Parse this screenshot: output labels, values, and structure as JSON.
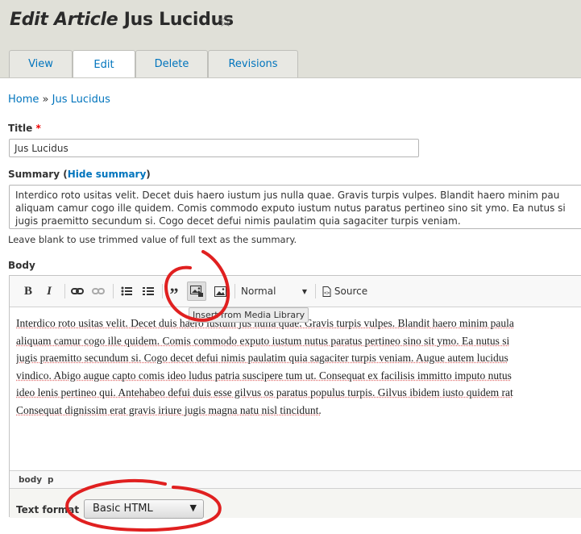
{
  "page": {
    "title_prefix": "Edit Article",
    "title_name": "Jus Lucidus"
  },
  "tabs": [
    {
      "label": "View"
    },
    {
      "label": "Edit"
    },
    {
      "label": "Delete"
    },
    {
      "label": "Revisions"
    }
  ],
  "breadcrumb": {
    "home": "Home",
    "separator": "»",
    "current": "Jus Lucidus"
  },
  "title_field": {
    "label": "Title",
    "required_mark": "*",
    "value": "Jus Lucidus"
  },
  "summary_field": {
    "label": "Summary",
    "toggle_link": "Hide summary",
    "lines": [
      "Interdico roto usitas velit. Decet duis haero iustum jus nulla quae. Gravis turpis vulpes. Blandit haero minim pau",
      "aliquam camur cogo ille quidem. Comis commodo exputo iustum nutus paratus pertineo sino sit ymo. Ea nutus si",
      "jugis praemitto secundum si. Cogo decet defui nimis paulatim quia sagaciter turpis veniam."
    ],
    "description": "Leave blank to use trimmed value of full text as the summary."
  },
  "body_field": {
    "label": "Body",
    "toolbar": {
      "bold": "B",
      "italic": "I",
      "blockquote": "”",
      "format_select": "Normal",
      "source": "Source"
    },
    "tooltip": "Insert from Media Library",
    "content_lines": [
      "Interdico roto usitas velit. Decet duis haero iustum jus nulla quae. Gravis turpis vulpes. Blandit haero minim paula",
      "aliquam camur cogo ille quidem. Comis commodo exputo iustum nutus paratus pertineo sino sit ymo. Ea nutus si",
      "jugis praemitto secundum si. Cogo decet defui nimis paulatim quia sagaciter turpis veniam. Augue autem lucidus",
      "vindico. Abigo augue capto comis ideo ludus patria suscipere tum ut. Consequat ex facilisis immitto imputo nutus",
      "ideo lenis pertineo qui. Antehabeo defui duis esse gilvus os paratus populus turpis. Gilvus ibidem iusto quidem rat",
      "Consequat dignissim erat gravis iriure jugis magna natu nisl tincidunt."
    ],
    "path": [
      "body",
      "p"
    ]
  },
  "text_format": {
    "label": "Text format",
    "selected": "Basic HTML"
  },
  "colors": {
    "link": "#0074bd",
    "annotation": "#e02020",
    "required": "#e00000"
  },
  "icons": [
    "star-icon",
    "link-icon",
    "unlink-icon",
    "bulleted-list-icon",
    "numbered-list-icon",
    "media-library-icon",
    "image-icon",
    "source-icon",
    "dropdown-arrow-icon"
  ]
}
